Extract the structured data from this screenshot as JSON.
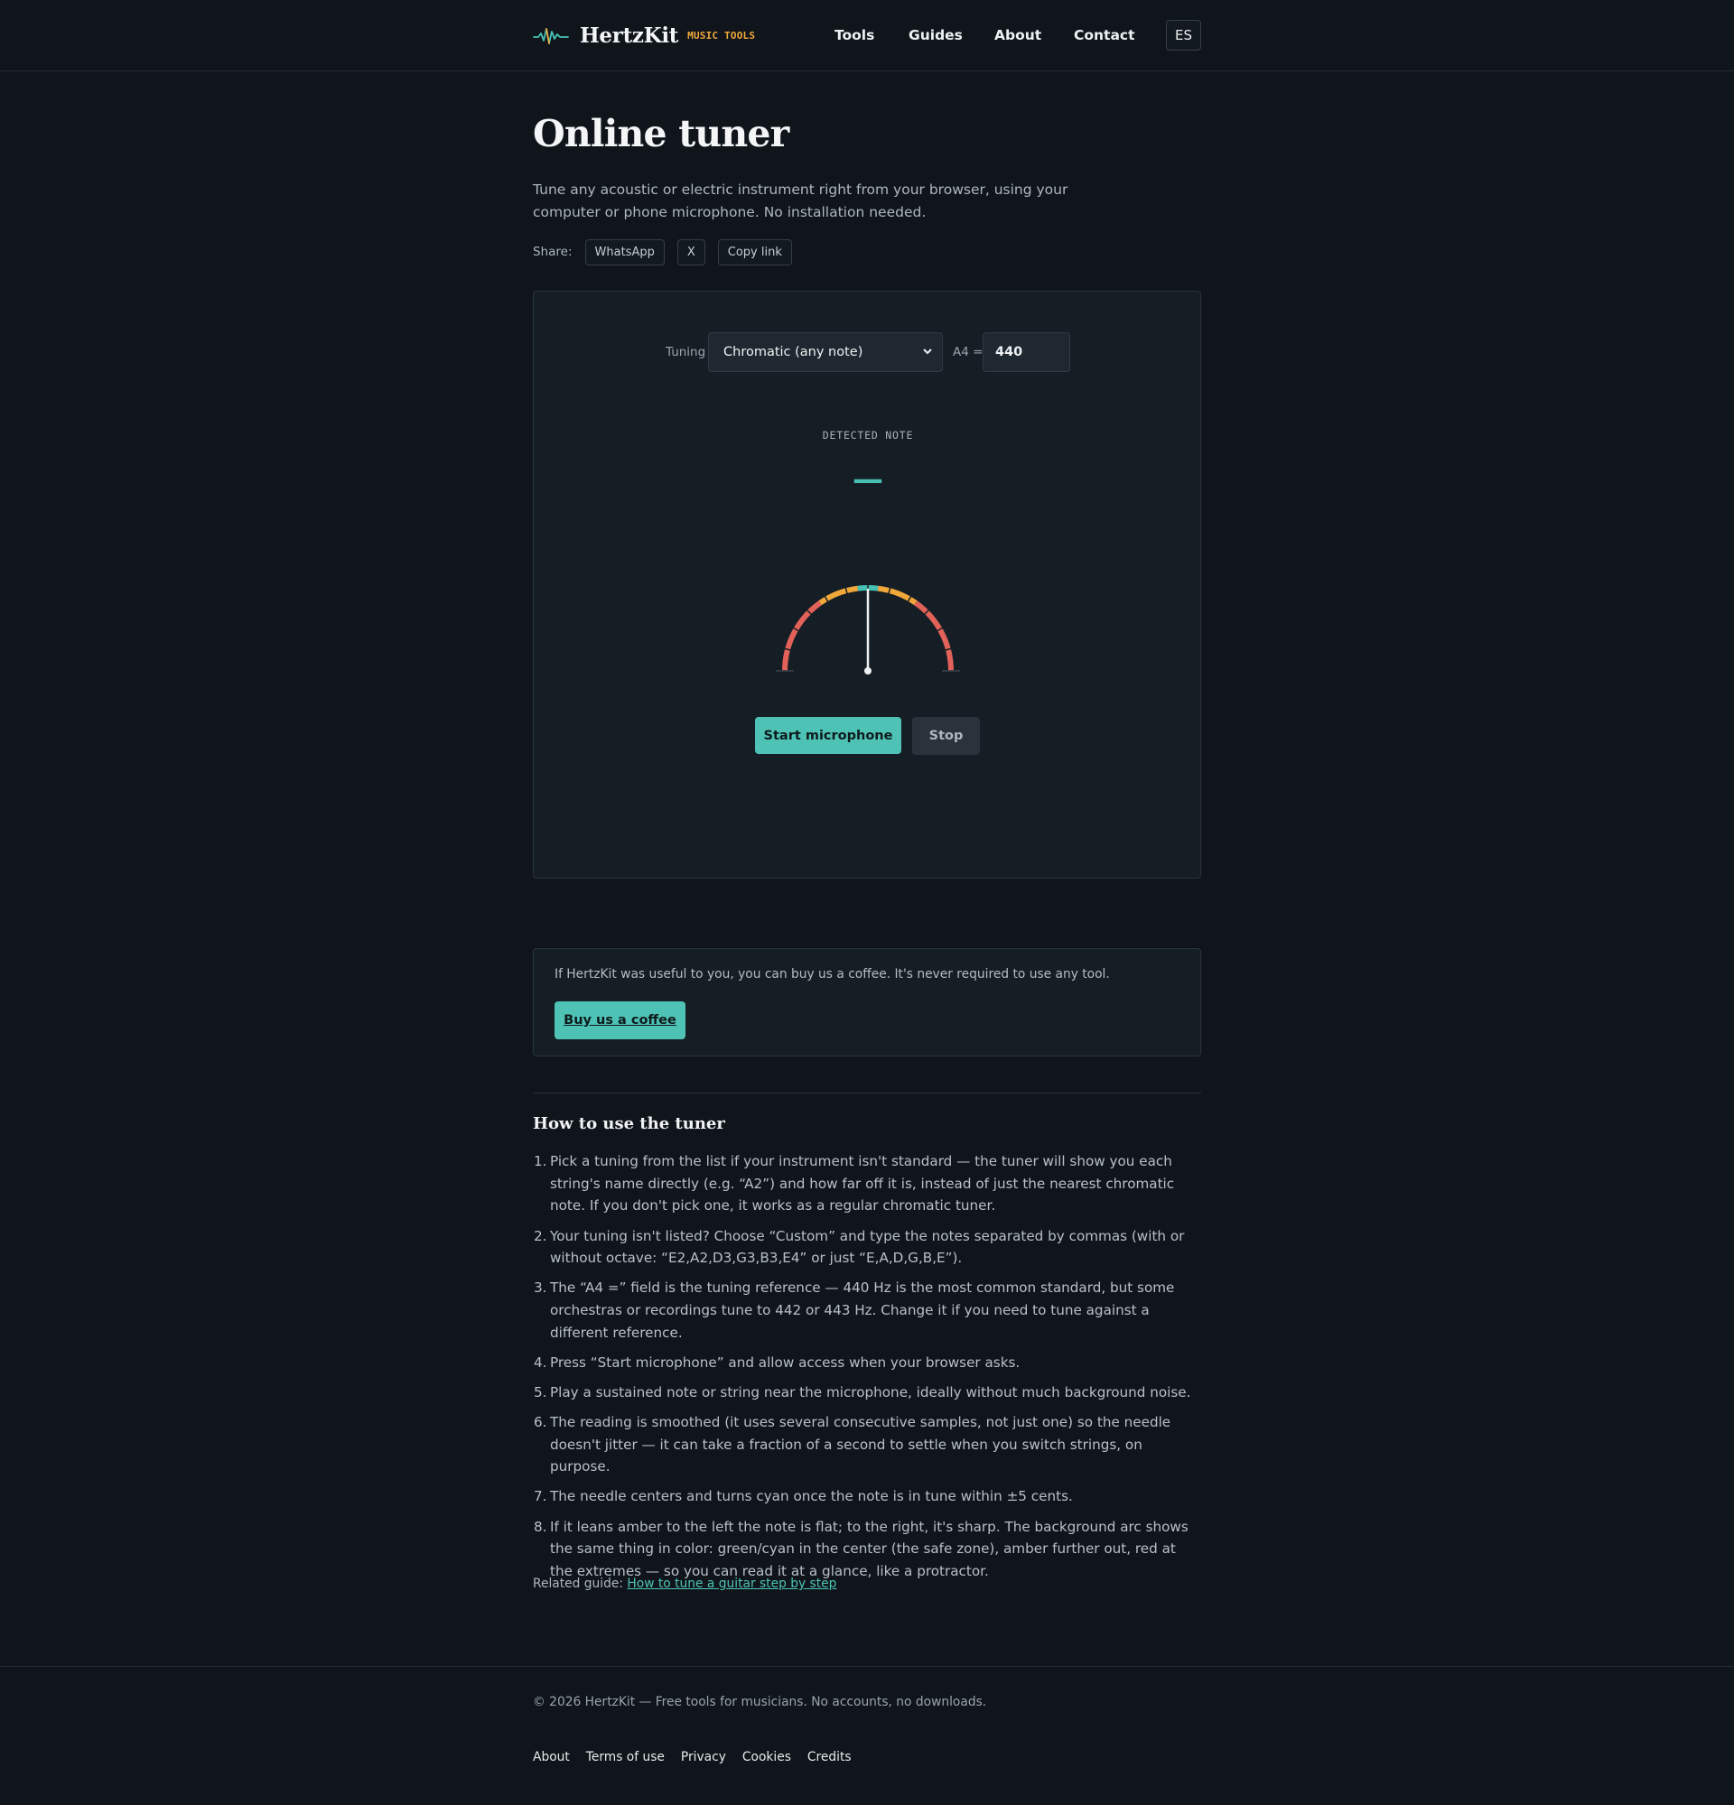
{
  "header": {
    "brand": "HertzKit",
    "tagline": "MUSIC TOOLS",
    "nav": [
      "Tools",
      "Guides",
      "About",
      "Contact"
    ],
    "lang": "ES"
  },
  "page": {
    "title": "Online tuner",
    "intro": "Tune any acoustic or electric instrument right from your browser, using your computer or phone microphone. No installation needed.",
    "share_label": "Share:",
    "share_buttons": [
      "WhatsApp",
      "X",
      "Copy link"
    ]
  },
  "tuner": {
    "tuning_label": "Tuning",
    "tuning_selected": "Chromatic (any note)",
    "a4_label": "A4 =",
    "a4_value": "440",
    "detected_label": "DETECTED NOTE",
    "detected_note": "—",
    "needle_cents": 0,
    "colors": {
      "in_tune": "#48c1b5",
      "near": "#f0a83a",
      "far": "#e2625a"
    },
    "start_label": "Start microphone",
    "stop_label": "Stop"
  },
  "support": {
    "text": "If HertzKit was useful to you, you can buy us a coffee. It's never required to use any tool.",
    "button": "Buy us a coffee"
  },
  "howto": {
    "title": "How to use the tuner",
    "steps": [
      "Pick a tuning from the list if your instrument isn't standard — the tuner will show you each string's name directly (e.g. “A2”) and how far off it is, instead of just the nearest chromatic note. If you don't pick one, it works as a regular chromatic tuner.",
      "Your tuning isn't listed? Choose “Custom” and type the notes separated by commas (with or without octave: “E2,A2,D3,G3,B3,E4” or just “E,A,D,G,B,E”).",
      "The “A4 =” field is the tuning reference — 440 Hz is the most common standard, but some orchestras or recordings tune to 442 or 443 Hz. Change it if you need to tune against a different reference.",
      "Press “Start microphone” and allow access when your browser asks.",
      "Play a sustained note or string near the microphone, ideally without much background noise.",
      "The reading is smoothed (it uses several consecutive samples, not just one) so the needle doesn't jitter — it can take a fraction of a second to settle when you switch strings, on purpose.",
      "The needle centers and turns cyan once the note is in tune within ±5 cents.",
      "If it leans amber to the left the note is flat; to the right, it's sharp. The background arc shows the same thing in color: green/cyan in the center (the safe zone), amber further out, red at the extremes — so you can read it at a glance, like a protractor."
    ],
    "related_label": "Related guide:",
    "related_link": "How to tune a guitar step by step"
  },
  "footer": {
    "copyright": "© 2026 HertzKit — Free tools for musicians. No accounts, no downloads.",
    "links": [
      "About",
      "Terms of use",
      "Privacy",
      "Cookies",
      "Credits"
    ]
  }
}
